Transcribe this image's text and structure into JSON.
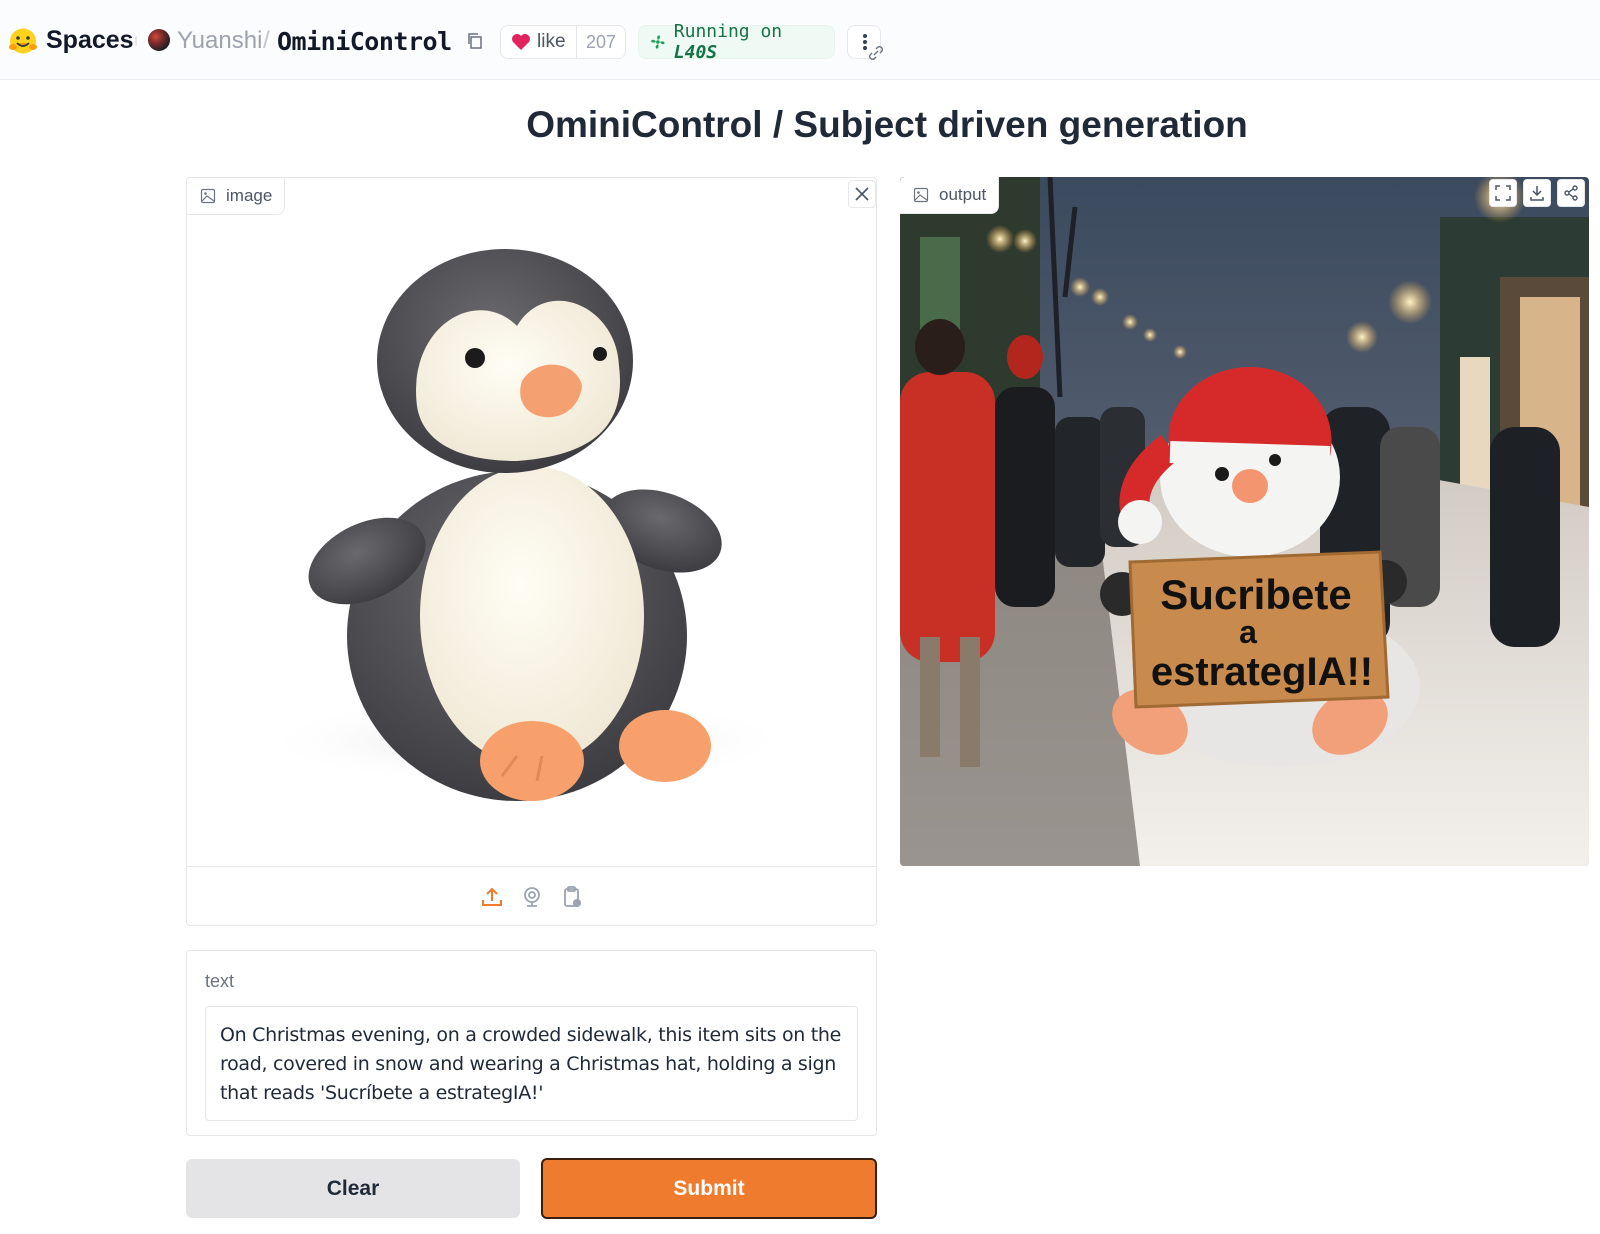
{
  "header": {
    "spaces_label": "Spaces",
    "owner": "Yuanshi",
    "separator": "/",
    "repo": "OminiControl",
    "like_label": "like",
    "like_count": "207",
    "running_prefix": "Running on ",
    "running_hardware": "L40S"
  },
  "main": {
    "title": "OminiControl / Subject driven generation"
  },
  "image_input": {
    "label": "image",
    "tools": [
      "upload-icon",
      "webcam-icon",
      "clipboard-icon"
    ]
  },
  "output": {
    "label": "output",
    "sign_text_line1": "Sucribete",
    "sign_text_line2": "a",
    "sign_text_line3": "estrategIA!!",
    "actions": [
      "fullscreen-icon",
      "download-icon",
      "share-icon"
    ]
  },
  "text_input": {
    "label": "text",
    "value": "On Christmas evening, on a crowded sidewalk, this item sits on the road, covered in snow and wearing a Christmas hat, holding a sign that reads 'Sucríbete a estrategIA!'"
  },
  "buttons": {
    "clear": "Clear",
    "submit": "Submit"
  },
  "colors": {
    "accent": "#ef7b2e",
    "running_text": "#157347",
    "like_heart": "#e0245e"
  }
}
